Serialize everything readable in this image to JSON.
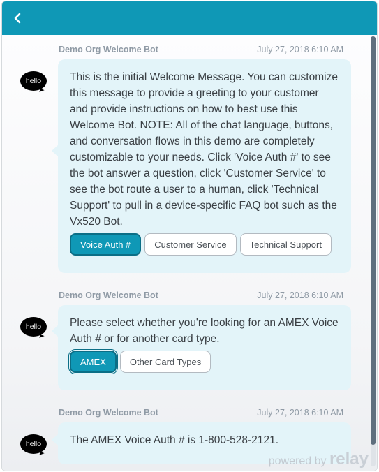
{
  "header": {
    "back_icon": "chevron-left-icon",
    "color": "#0f98b6"
  },
  "messages": [
    {
      "sender": "Demo Org Welcome Bot",
      "time": "July 27, 2018 6:10 AM",
      "avatar": "hello",
      "text": "This is the initial Welcome Message. You can customize this message to provide a greeting to your customer and provide instructions on how to best use this Welcome Bot. NOTE: All of the chat language, buttons, and conversation flows in this demo are completely customizable to your needs. Click 'Voice Auth #' to see the bot answer a question, click 'Customer Service' to see the bot route a user to a human, click 'Technical Support' to pull in a device-specific FAQ bot such as the Vx520 Bot.",
      "buttons": [
        "Voice Auth #",
        "Customer Service",
        "Technical Support"
      ]
    },
    {
      "sender": "Demo Org Welcome Bot",
      "time": "July 27, 2018 6:10 AM",
      "avatar": "hello",
      "text": "Please select whether you're looking for an AMEX Voice Auth # or for another card type.",
      "buttons": [
        "AMEX",
        "Other Card Types"
      ]
    },
    {
      "sender": "Demo Org Welcome Bot",
      "time": "July 27, 2018 6:10 AM",
      "avatar": "hello",
      "text": "The AMEX Voice Auth # is 1-800-528-2121."
    }
  ],
  "footer": {
    "powered_prefix": "powered by",
    "brand": "relay"
  },
  "colors": {
    "accent": "#0f98b6",
    "bubble": "#e3f4f9"
  }
}
